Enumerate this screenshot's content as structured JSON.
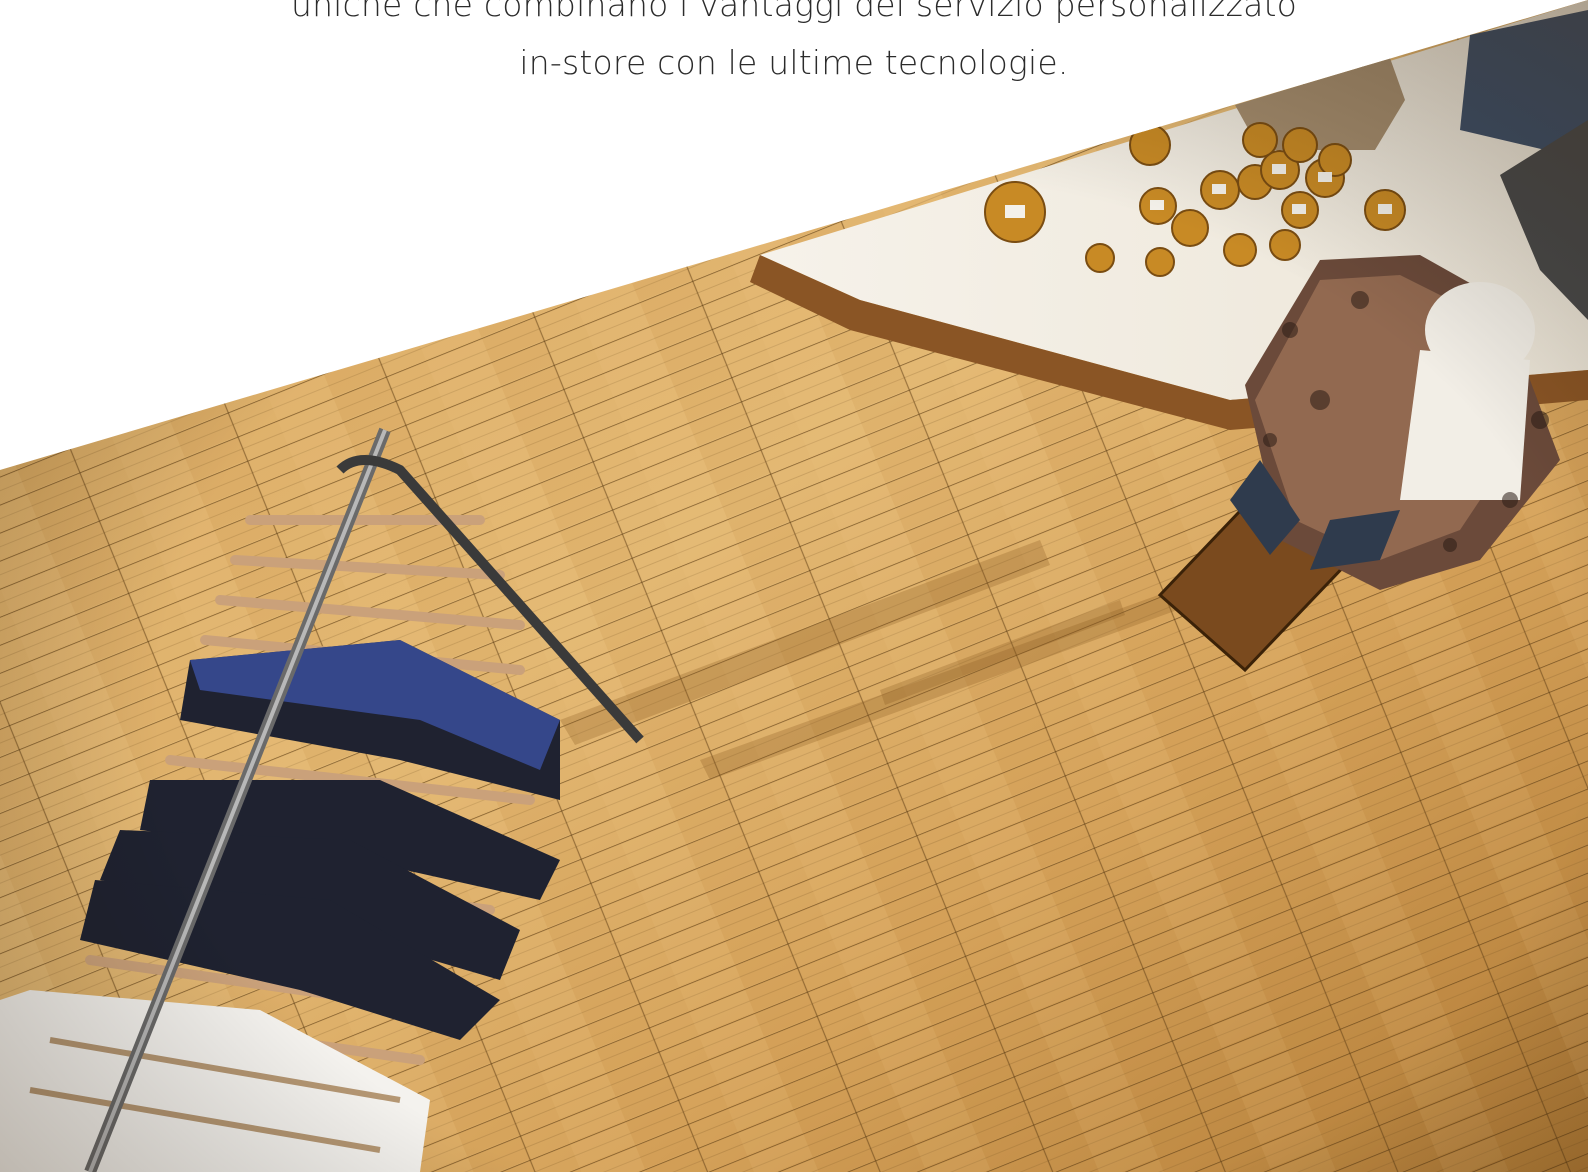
{
  "intro": {
    "line1": "uniche che combinano i vantaggi del servizio personalizzato",
    "line2": "in-store con le ultime tecnologie."
  },
  "hero_image": {
    "subject": "store-floor-photo"
  },
  "colors": {
    "background": "#ffffff",
    "text": "#2b2b2b",
    "floor_light": "#e0b36d",
    "floor_mid": "#c98f45",
    "floor_dark": "#8a5a22",
    "table": "#f3efe6"
  }
}
